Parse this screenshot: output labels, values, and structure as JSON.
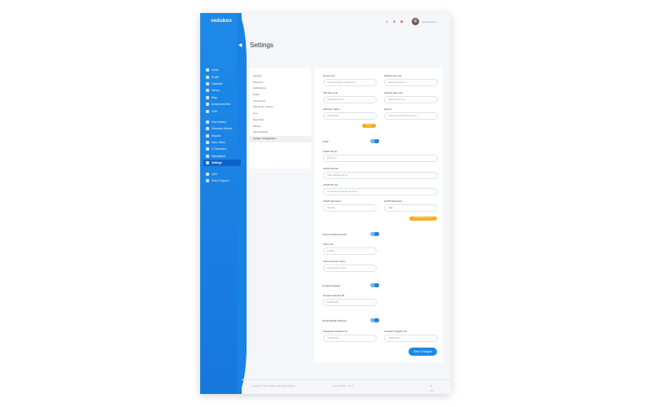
{
  "app": {
    "logo": "vedubox"
  },
  "colors": {
    "primary": "#1a82e4",
    "accent": "#f2b01e"
  },
  "sidebar": {
    "items": [
      {
        "label": "Home",
        "icon": "home-icon"
      },
      {
        "label": "Profile",
        "icon": "user-icon"
      },
      {
        "label": "Calendar",
        "icon": "calendar-icon"
      },
      {
        "label": "Library",
        "icon": "book-icon"
      },
      {
        "label": "Blog",
        "icon": "edit-icon"
      },
      {
        "label": "Announcements",
        "icon": "megaphone-icon"
      },
      {
        "label": "Polls",
        "icon": "chart-icon"
      }
    ],
    "items2": [
      {
        "label": "User Actions",
        "icon": "users-icon"
      },
      {
        "label": "Education Actions",
        "icon": "graduation-icon"
      },
      {
        "label": "Reports",
        "icon": "report-icon"
      },
      {
        "label": "Menu Items",
        "icon": "menu-icon"
      },
      {
        "label": "E-Commerce",
        "icon": "cart-icon"
      },
      {
        "label": "Marketplace",
        "icon": "store-icon"
      },
      {
        "label": "Settings",
        "icon": "gear-icon",
        "active": true
      }
    ],
    "items3": [
      {
        "label": "Q&A",
        "icon": "question-icon"
      },
      {
        "label": "Help & Support",
        "icon": "help-icon"
      }
    ]
  },
  "header": {
    "user_name": "User Name"
  },
  "page": {
    "title": "Settings"
  },
  "settings_nav": [
    {
      "label": "General"
    },
    {
      "label": "Payment"
    },
    {
      "label": "Notifications"
    },
    {
      "label": "Email"
    },
    {
      "label": "Instructions"
    },
    {
      "label": "Test Exam Course"
    },
    {
      "label": "Live"
    },
    {
      "label": "Recorded"
    },
    {
      "label": "Banner"
    },
    {
      "label": "View Settings"
    },
    {
      "label": "System & Integration",
      "active": true
    }
  ],
  "form": {
    "home_link": {
      "label": "Home Link",
      "value": "https://blogvedox.vedubox.com"
    },
    "subdomain_link": {
      "label": "Subdomain Link",
      "value": "https://blogname.uz"
    },
    "ios_app_link": {
      "label": "iOS App Link",
      "value": "//apps.fastlink.com"
    },
    "android_app_link": {
      "label": "Android App Link",
      "value": "//apps.fastlink.com"
    },
    "vedubox_token": {
      "label": "Vedubox Token",
      "value": "T0dEbGXtE"
    },
    "iframe": {
      "label": "iFrame",
      "value": "<iframe src='//vedubox.iframe'>"
    },
    "token_button": "Generate",
    "ldap": {
      "label": "LDAP"
    },
    "ldap_server": {
      "label": "LDAP Server",
      "value": "10.0.0.0.0"
    },
    "ldap_domain": {
      "label": "LDAP Domain",
      "value": "https://ldapdomain.uz"
    },
    "ldap_dn": {
      "label": "LDAP DN (to)",
      "value": "ou=users,dc=company,dc=local"
    },
    "ldap_username": {
      "label": "LDAP Username",
      "value": "ldapuser"
    },
    "ldap_password": {
      "label": "LDAP Password",
      "value": "••••••"
    },
    "ldap_button": "Test LDAP Connection",
    "vimeo": {
      "label": "Vimeo Private Account"
    },
    "vimeo_id": {
      "label": "Vimeo ID",
      "value": "122345"
    },
    "vimeo_token": {
      "label": "Vimeo Access Token",
      "value": "access-token-vimeo"
    },
    "google_analytics": {
      "label": "Google Analytics"
    },
    "google_analytics_id": {
      "label": "Google Analytics ID",
      "value": "T0dEbGXtE"
    },
    "social_analytics": {
      "label": "Social Media Analytics"
    },
    "facebook_id": {
      "label": "Facebook Analytics ID",
      "value": "T0dEbGXtE"
    },
    "linkedin_id": {
      "label": "LinkedIn Analytics ID",
      "value": "T0dEbGXtE"
    },
    "save": "Save Changes"
  },
  "footer": {
    "copyright": "Copyright © 2020 Vedubox. All rights reserved.",
    "middle": "Privacy Policy · Terms",
    "lang": "EN"
  }
}
